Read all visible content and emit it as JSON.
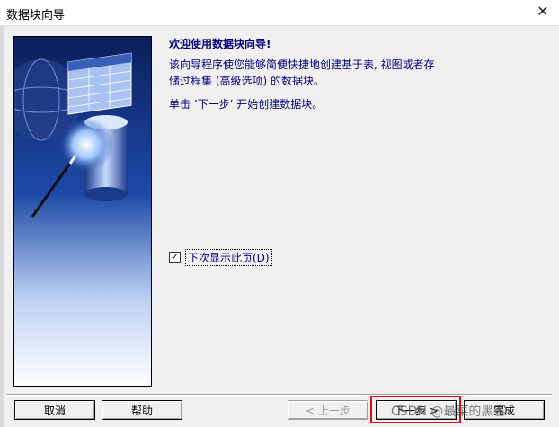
{
  "window": {
    "title": "数据块向导",
    "close_glyph": "✕"
  },
  "content": {
    "heading": "欢迎使用数据块向导!",
    "paragraph1": "该向导程序使您能够简便快捷地创建基于表, 视图或者存储过程集 (高级选项) 的数据块。",
    "paragraph2": "单击 ’下一步’ 开始创建数据块。"
  },
  "checkbox": {
    "checked": true,
    "mark": "✓",
    "label": "下次显示此页(D)"
  },
  "buttons": {
    "cancel": "取消",
    "help": "帮助",
    "back": "< 上一步",
    "next": "下一步 >",
    "finish": "完成"
  },
  "watermark": "CSDN @最菜的黑客",
  "colors": {
    "text_accent": "#000080",
    "highlight": "#e01010"
  }
}
